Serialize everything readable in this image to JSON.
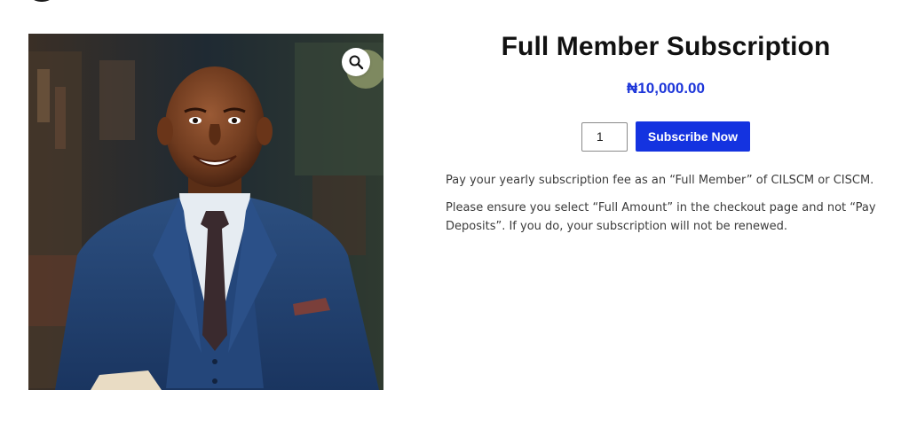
{
  "product": {
    "title": "Full Member Subscription",
    "price": "₦10,000.00",
    "image_alt": "Smiling man in navy blue three-piece suit",
    "zoom_icon": "magnifier-icon"
  },
  "cart": {
    "quantity": "1",
    "button_label": "Subscribe Now"
  },
  "description": {
    "paragraphs": [
      "Pay your yearly subscription fee as an “Full Member” of CILSCM or CISCM.",
      "Please ensure you select “Full Amount” in the checkout page and not “Pay Deposits”. If you do, your subscription will not be renewed."
    ]
  },
  "colors": {
    "accent": "#1433e0",
    "price": "#1c35d9",
    "title": "#111111",
    "body_text": "#3b3b3b"
  }
}
